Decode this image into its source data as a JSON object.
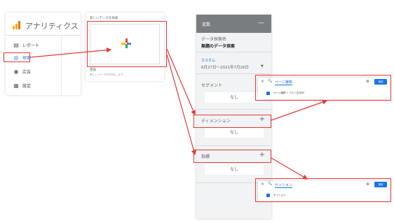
{
  "colors": {
    "accent_red": "#e53935",
    "blue": "#1a73e8",
    "logo_orange": "#f9ab00",
    "logo_dark_orange": "#e37400",
    "header_gray": "#7a7d80",
    "plus_red": "#ea4335",
    "plus_blue": "#4285f4",
    "plus_yellow": "#fbbc04",
    "plus_green": "#34a853"
  },
  "sidebar": {
    "logo_icon": "analytics-logo-icon",
    "title": "アナリティクス",
    "items": [
      {
        "icon": "report-icon",
        "glyph": "▤",
        "label": "レポート"
      },
      {
        "icon": "explore-icon",
        "glyph": "◎",
        "label": "探索"
      },
      {
        "icon": "ads-icon",
        "glyph": "◉",
        "label": "広告"
      },
      {
        "icon": "settings-icon",
        "glyph": "▦",
        "label": "設定"
      }
    ]
  },
  "new_exploration": {
    "header": "新しいデータを探索",
    "caption_title": "空白",
    "caption_sub": "新しいデータを作成します",
    "plus_icon": "google-plus-icon"
  },
  "variables": {
    "title": "変数",
    "minimize": "—",
    "exploration_name_label": "データ探索名",
    "exploration_name": "無題のデータ探索",
    "date_label": "カスタム",
    "date_range": "6月27日～2021年7月26日",
    "date_dropdown": "▼",
    "segments_label": "セグメント",
    "segments_value": "なし",
    "dimensions_label": "ディメンション",
    "dimensions_value": "なし",
    "metrics_label": "指標",
    "metrics_value": "なし",
    "add": "+"
  },
  "dimension_picker": {
    "close": "×",
    "search_icon": "🔍",
    "query": "ページ遷移",
    "clear": "⊗",
    "apply": "適用",
    "option": "ページ遷移 + クエリ文字列"
  },
  "metric_picker": {
    "close": "×",
    "search_icon": "🔍",
    "query": "セッション",
    "clear": "⊗",
    "apply": "適用",
    "option": "セッション"
  }
}
